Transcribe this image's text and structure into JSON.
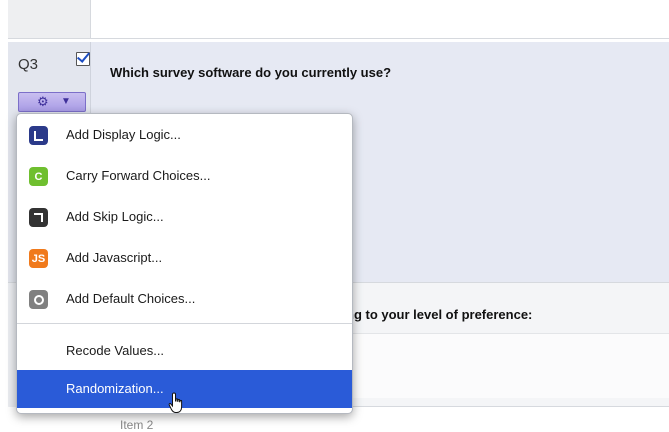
{
  "question": {
    "number": "Q3",
    "text": "Which survey software do you currently use?"
  },
  "next_question": {
    "text_fragment": "ng to your level of preference:",
    "item_label": "Item 2"
  },
  "menu": {
    "items": [
      {
        "label": "Add Display Logic...",
        "icon": "display-logic-icon",
        "color": "#2b3a8a"
      },
      {
        "label": "Carry Forward Choices...",
        "icon": "carry-forward-icon",
        "icon_text": "C",
        "color": "#6fbf2f"
      },
      {
        "label": "Add Skip Logic...",
        "icon": "skip-logic-icon",
        "color": "#333333"
      },
      {
        "label": "Add Javascript...",
        "icon": "javascript-icon",
        "icon_text": "JS",
        "color": "#f07a1c"
      },
      {
        "label": "Add Default Choices...",
        "icon": "default-choices-icon",
        "color": "#808080"
      },
      {
        "label": "Recode Values..."
      },
      {
        "label": "Randomization...",
        "selected": true
      }
    ],
    "highlight_color": "#2a5bd8"
  },
  "gear_menu_button": {
    "icon": "gear-icon",
    "chevron": "chevron-down-icon"
  }
}
